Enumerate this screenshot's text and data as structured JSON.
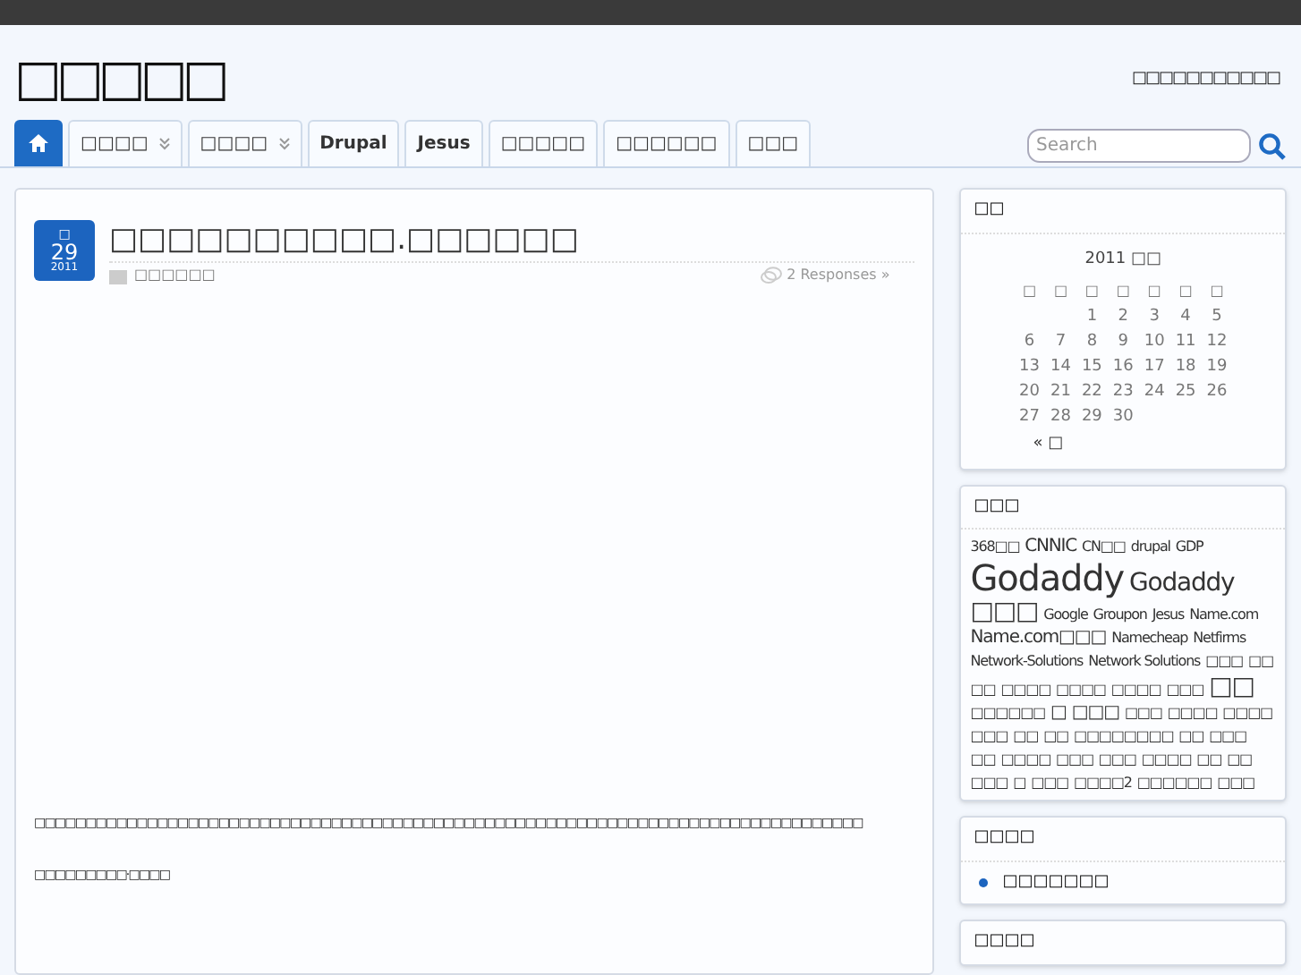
{
  "site": {
    "title": "□□□□□",
    "tagline": "□□□□□□□□□□□"
  },
  "nav": [
    {
      "kind": "home",
      "selected": true
    },
    {
      "kind": "label",
      "label": "□□□□",
      "dropdown": true,
      "selected": false
    },
    {
      "kind": "label",
      "label": "□□□□",
      "dropdown": true,
      "selected": false
    },
    {
      "kind": "label",
      "label": "Drupal",
      "dropdown": false,
      "selected": false
    },
    {
      "kind": "label",
      "label": "Jesus",
      "dropdown": false,
      "selected": false
    },
    {
      "kind": "label",
      "label": "□□□□□",
      "dropdown": false,
      "selected": false
    },
    {
      "kind": "label",
      "label": "□□□□□□",
      "dropdown": false,
      "selected": false
    },
    {
      "kind": "label",
      "label": "□□□",
      "dropdown": false,
      "selected": false
    }
  ],
  "search": {
    "placeholder": "Search"
  },
  "post": {
    "date": {
      "month": "□",
      "day": "29",
      "year": "2011"
    },
    "title": "□□□□□□□□□□.□□□□□□",
    "category": "□□□□□□",
    "responses": "2 Responses »",
    "paragraphs": [
      "□□□□□□□□□□□□□□□□□□□□□□□□□□□□□□□□□□□□□□□□□□□□□□□□□□□□□□□□□□□□□□□□□□□□□□□□□□□□□□□□□",
      "□□□□□□□□□·□□□□"
    ]
  },
  "calendar": {
    "title": "□□",
    "caption": "2011 □□",
    "weekdays": [
      "□",
      "□",
      "□",
      "□",
      "□",
      "□",
      "□"
    ],
    "weeks": [
      [
        "1",
        "2",
        "3",
        "4",
        "5"
      ],
      [
        "6",
        "7",
        "8",
        "9",
        "10",
        "11",
        "12"
      ],
      [
        "13",
        "14",
        "15",
        "16",
        "17",
        "18",
        "19"
      ],
      [
        "20",
        "21",
        "22",
        "23",
        "24",
        "25",
        "26"
      ],
      [
        "27",
        "28",
        "29",
        "30"
      ]
    ],
    "prev": "« □"
  },
  "tags": {
    "title": "□□□",
    "items": [
      {
        "label": "368□□",
        "kind": "minor"
      },
      {
        "label": "CNNIC",
        "kind": "normal"
      },
      {
        "label": "CN□□",
        "kind": "minor"
      },
      {
        "label": "drupal",
        "kind": "minor"
      },
      {
        "label": "GDP",
        "kind": "minor"
      },
      {
        "label": "Godaddy",
        "kind": "top"
      },
      {
        "label": "Godaddy",
        "kind": "major"
      },
      {
        "label": "□□□",
        "kind": "major"
      },
      {
        "label": "Google",
        "kind": "minor"
      },
      {
        "label": "Groupon",
        "kind": "minor"
      },
      {
        "label": "Jesus",
        "kind": "minor"
      },
      {
        "label": "Name.com",
        "kind": "minor"
      },
      {
        "label": "Name.com□□□",
        "kind": "normal"
      },
      {
        "label": "Namecheap",
        "kind": "minor"
      },
      {
        "label": "Netfirms",
        "kind": "minor"
      },
      {
        "label": "Network-Solutions",
        "kind": "minor"
      },
      {
        "label": "Network Solutions",
        "kind": "minor"
      },
      {
        "label": "□□□",
        "kind": "minor"
      },
      {
        "label": "□□",
        "kind": "minor"
      },
      {
        "label": "□□",
        "kind": "minor"
      },
      {
        "label": "□□□□",
        "kind": "minor"
      },
      {
        "label": "□□□□",
        "kind": "minor"
      },
      {
        "label": "□□□□",
        "kind": "minor"
      },
      {
        "label": "□□□",
        "kind": "minor"
      },
      {
        "label": "□□",
        "kind": "major"
      },
      {
        "label": "□□□□□□",
        "kind": "minor"
      },
      {
        "label": "□",
        "kind": "normal"
      },
      {
        "label": "□□□",
        "kind": "normal"
      },
      {
        "label": "□□□",
        "kind": "minor"
      },
      {
        "label": "□□□□",
        "kind": "minor"
      },
      {
        "label": "□□□□",
        "kind": "minor"
      },
      {
        "label": "□□□",
        "kind": "minor"
      },
      {
        "label": "□□",
        "kind": "minor"
      },
      {
        "label": "□□",
        "kind": "minor"
      },
      {
        "label": "□□□□□□□□",
        "kind": "minor"
      },
      {
        "label": "□□",
        "kind": "minor"
      },
      {
        "label": "□□□",
        "kind": "minor"
      },
      {
        "label": "□□",
        "kind": "minor"
      },
      {
        "label": "□□□□",
        "kind": "minor"
      },
      {
        "label": "□□□",
        "kind": "minor"
      },
      {
        "label": "□□□",
        "kind": "minor"
      },
      {
        "label": "□□□□",
        "kind": "minor"
      },
      {
        "label": "□□",
        "kind": "minor"
      },
      {
        "label": "□□",
        "kind": "minor"
      },
      {
        "label": "□□□",
        "kind": "minor"
      },
      {
        "label": "□",
        "kind": "minor"
      },
      {
        "label": "□□□",
        "kind": "minor"
      },
      {
        "label": "□□□□2",
        "kind": "minor"
      },
      {
        "label": "□□□□□□",
        "kind": "minor"
      },
      {
        "label": "□□□",
        "kind": "minor"
      }
    ]
  },
  "links": {
    "title": "□□□□",
    "items": [
      "□□□□□□□"
    ]
  },
  "next_widget": {
    "title": "□□□□"
  }
}
